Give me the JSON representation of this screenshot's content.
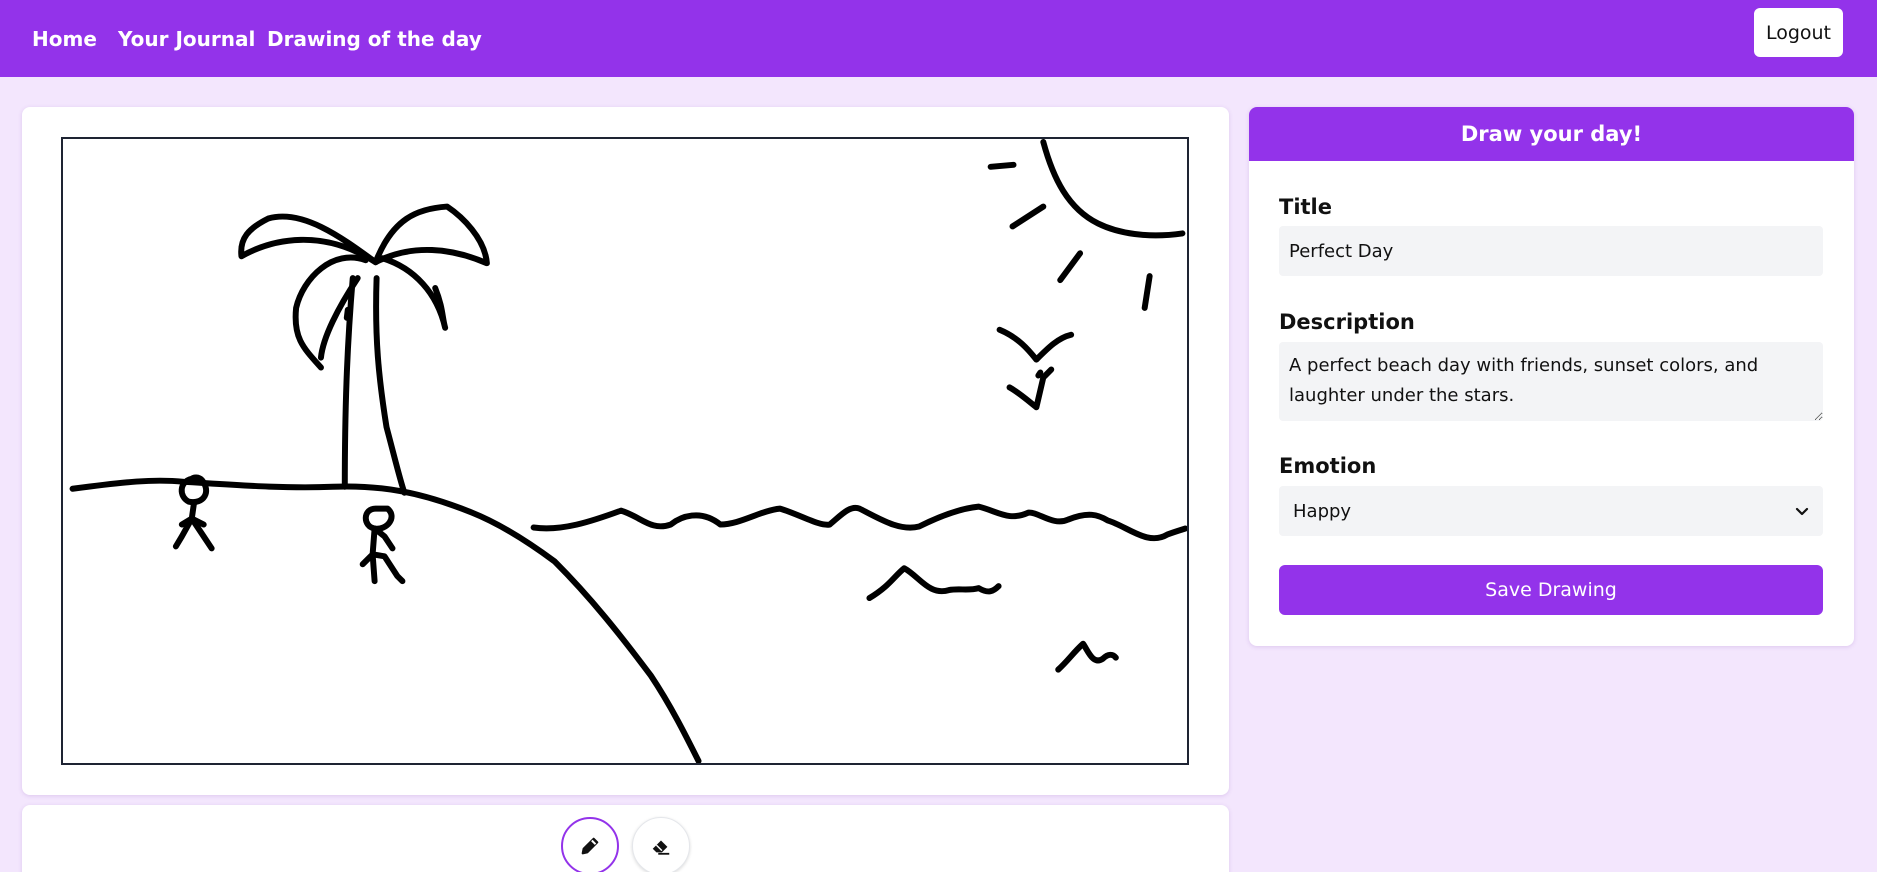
{
  "nav": {
    "links": [
      {
        "label": "Home"
      },
      {
        "label": "Your Journal"
      },
      {
        "label": "Drawing of the day"
      }
    ],
    "logout_label": "Logout"
  },
  "tools": {
    "pencil_icon": "pencil-icon",
    "eraser_icon": "eraser-icon",
    "active": "pencil"
  },
  "form": {
    "header": "Draw your day!",
    "title_label": "Title",
    "title_value": "Perfect Day",
    "description_label": "Description",
    "description_value": "A perfect beach day with friends, sunset colors, and laughter under the stars.",
    "emotion_label": "Emotion",
    "emotion_value": "Happy",
    "save_label": "Save Drawing"
  },
  "colors": {
    "accent": "#9333ea",
    "page_background": "#f3e6fd",
    "field_background": "#f3f4f6"
  }
}
